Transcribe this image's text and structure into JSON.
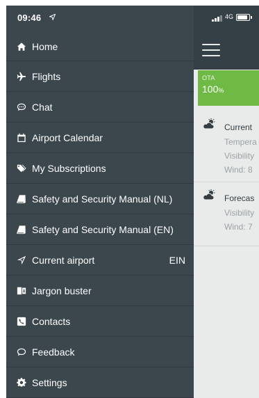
{
  "status_bar": {
    "time": "09:46",
    "network": "4G"
  },
  "app": {
    "ota": {
      "label": "OTA",
      "value": "100",
      "unit": "%"
    },
    "current": {
      "title": "Current",
      "lines": [
        "Tempera",
        "Visibility",
        "Wind: 8"
      ]
    },
    "forecast": {
      "title": "Forecas",
      "lines": [
        "Visibility",
        "Wind: 7"
      ]
    }
  },
  "menu": {
    "items": [
      {
        "label": "Home",
        "icon": "home-icon"
      },
      {
        "label": "Flights",
        "icon": "plane-icon"
      },
      {
        "label": "Chat",
        "icon": "chat-bubble-icon"
      },
      {
        "label": "Airport Calendar",
        "icon": "calendar-icon"
      },
      {
        "label": "My Subscriptions",
        "icon": "tags-icon"
      },
      {
        "label": "Safety and Security Manual (NL)",
        "icon": "book-icon"
      },
      {
        "label": "Safety and Security Manual (EN)",
        "icon": "book-icon"
      },
      {
        "label": "Current airport",
        "icon": "location-arrow-icon",
        "extra": "EIN"
      },
      {
        "label": "Jargon buster",
        "icon": "translate-book-icon"
      },
      {
        "label": "Contacts",
        "icon": "phone-square-icon"
      },
      {
        "label": "Feedback",
        "icon": "comment-icon"
      },
      {
        "label": "Settings",
        "icon": "gear-icon"
      }
    ]
  },
  "colors": {
    "drawer_bg": "#3b464d",
    "header_bg": "#343f46",
    "ota_green": "#6fba45",
    "content_bg": "#e9ebea"
  }
}
